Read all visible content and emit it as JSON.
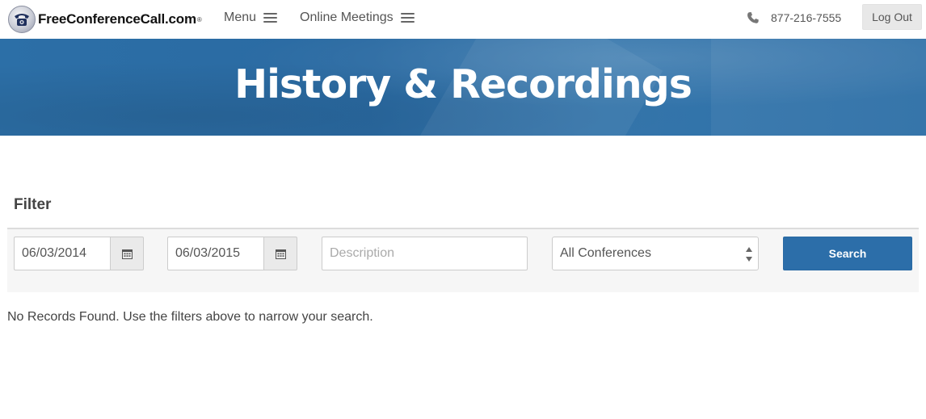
{
  "nav": {
    "logo_text": "FreeConferenceCall.com",
    "logo_reg": "®",
    "menu_label": "Menu",
    "online_meetings_label": "Online Meetings",
    "phone": "877-216-7555",
    "logout_label": "Log Out"
  },
  "hero": {
    "title": "History & Recordings"
  },
  "filter": {
    "title": "Filter",
    "start_date": "06/03/2014",
    "end_date": "06/03/2015",
    "description_placeholder": "Description",
    "description_value": "",
    "conference_selected": "All Conferences",
    "search_label": "Search"
  },
  "results": {
    "empty_message": "No Records Found. Use the filters above to narrow your search."
  },
  "colors": {
    "brand_blue": "#2c6ea9",
    "hero_blue": "#2c6fa7",
    "panel_bg": "#f6f6f6"
  },
  "icons": [
    "logo-phone-icon",
    "hamburger-icon",
    "phone-icon",
    "calendar-icon",
    "select-arrows-icon"
  ]
}
